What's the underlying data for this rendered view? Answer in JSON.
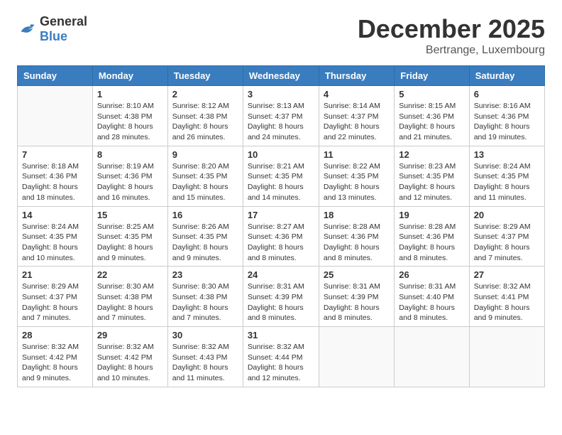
{
  "header": {
    "logo_general": "General",
    "logo_blue": "Blue",
    "month_title": "December 2025",
    "location": "Bertrange, Luxembourg"
  },
  "calendar": {
    "days_of_week": [
      "Sunday",
      "Monday",
      "Tuesday",
      "Wednesday",
      "Thursday",
      "Friday",
      "Saturday"
    ],
    "weeks": [
      [
        {
          "day": "",
          "empty": true
        },
        {
          "day": "1",
          "sunrise": "8:10 AM",
          "sunset": "4:38 PM",
          "daylight": "8 hours and 28 minutes."
        },
        {
          "day": "2",
          "sunrise": "8:12 AM",
          "sunset": "4:38 PM",
          "daylight": "8 hours and 26 minutes."
        },
        {
          "day": "3",
          "sunrise": "8:13 AM",
          "sunset": "4:37 PM",
          "daylight": "8 hours and 24 minutes."
        },
        {
          "day": "4",
          "sunrise": "8:14 AM",
          "sunset": "4:37 PM",
          "daylight": "8 hours and 22 minutes."
        },
        {
          "day": "5",
          "sunrise": "8:15 AM",
          "sunset": "4:36 PM",
          "daylight": "8 hours and 21 minutes."
        },
        {
          "day": "6",
          "sunrise": "8:16 AM",
          "sunset": "4:36 PM",
          "daylight": "8 hours and 19 minutes."
        }
      ],
      [
        {
          "day": "7",
          "sunrise": "8:18 AM",
          "sunset": "4:36 PM",
          "daylight": "8 hours and 18 minutes."
        },
        {
          "day": "8",
          "sunrise": "8:19 AM",
          "sunset": "4:36 PM",
          "daylight": "8 hours and 16 minutes."
        },
        {
          "day": "9",
          "sunrise": "8:20 AM",
          "sunset": "4:35 PM",
          "daylight": "8 hours and 15 minutes."
        },
        {
          "day": "10",
          "sunrise": "8:21 AM",
          "sunset": "4:35 PM",
          "daylight": "8 hours and 14 minutes."
        },
        {
          "day": "11",
          "sunrise": "8:22 AM",
          "sunset": "4:35 PM",
          "daylight": "8 hours and 13 minutes."
        },
        {
          "day": "12",
          "sunrise": "8:23 AM",
          "sunset": "4:35 PM",
          "daylight": "8 hours and 12 minutes."
        },
        {
          "day": "13",
          "sunrise": "8:24 AM",
          "sunset": "4:35 PM",
          "daylight": "8 hours and 11 minutes."
        }
      ],
      [
        {
          "day": "14",
          "sunrise": "8:24 AM",
          "sunset": "4:35 PM",
          "daylight": "8 hours and 10 minutes."
        },
        {
          "day": "15",
          "sunrise": "8:25 AM",
          "sunset": "4:35 PM",
          "daylight": "8 hours and 9 minutes."
        },
        {
          "day": "16",
          "sunrise": "8:26 AM",
          "sunset": "4:35 PM",
          "daylight": "8 hours and 9 minutes."
        },
        {
          "day": "17",
          "sunrise": "8:27 AM",
          "sunset": "4:36 PM",
          "daylight": "8 hours and 8 minutes."
        },
        {
          "day": "18",
          "sunrise": "8:28 AM",
          "sunset": "4:36 PM",
          "daylight": "8 hours and 8 minutes."
        },
        {
          "day": "19",
          "sunrise": "8:28 AM",
          "sunset": "4:36 PM",
          "daylight": "8 hours and 8 minutes."
        },
        {
          "day": "20",
          "sunrise": "8:29 AM",
          "sunset": "4:37 PM",
          "daylight": "8 hours and 7 minutes."
        }
      ],
      [
        {
          "day": "21",
          "sunrise": "8:29 AM",
          "sunset": "4:37 PM",
          "daylight": "8 hours and 7 minutes."
        },
        {
          "day": "22",
          "sunrise": "8:30 AM",
          "sunset": "4:38 PM",
          "daylight": "8 hours and 7 minutes."
        },
        {
          "day": "23",
          "sunrise": "8:30 AM",
          "sunset": "4:38 PM",
          "daylight": "8 hours and 7 minutes."
        },
        {
          "day": "24",
          "sunrise": "8:31 AM",
          "sunset": "4:39 PM",
          "daylight": "8 hours and 8 minutes."
        },
        {
          "day": "25",
          "sunrise": "8:31 AM",
          "sunset": "4:39 PM",
          "daylight": "8 hours and 8 minutes."
        },
        {
          "day": "26",
          "sunrise": "8:31 AM",
          "sunset": "4:40 PM",
          "daylight": "8 hours and 8 minutes."
        },
        {
          "day": "27",
          "sunrise": "8:32 AM",
          "sunset": "4:41 PM",
          "daylight": "8 hours and 9 minutes."
        }
      ],
      [
        {
          "day": "28",
          "sunrise": "8:32 AM",
          "sunset": "4:42 PM",
          "daylight": "8 hours and 9 minutes."
        },
        {
          "day": "29",
          "sunrise": "8:32 AM",
          "sunset": "4:42 PM",
          "daylight": "8 hours and 10 minutes."
        },
        {
          "day": "30",
          "sunrise": "8:32 AM",
          "sunset": "4:43 PM",
          "daylight": "8 hours and 11 minutes."
        },
        {
          "day": "31",
          "sunrise": "8:32 AM",
          "sunset": "4:44 PM",
          "daylight": "8 hours and 12 minutes."
        },
        {
          "day": "",
          "empty": true
        },
        {
          "day": "",
          "empty": true
        },
        {
          "day": "",
          "empty": true
        }
      ]
    ]
  }
}
